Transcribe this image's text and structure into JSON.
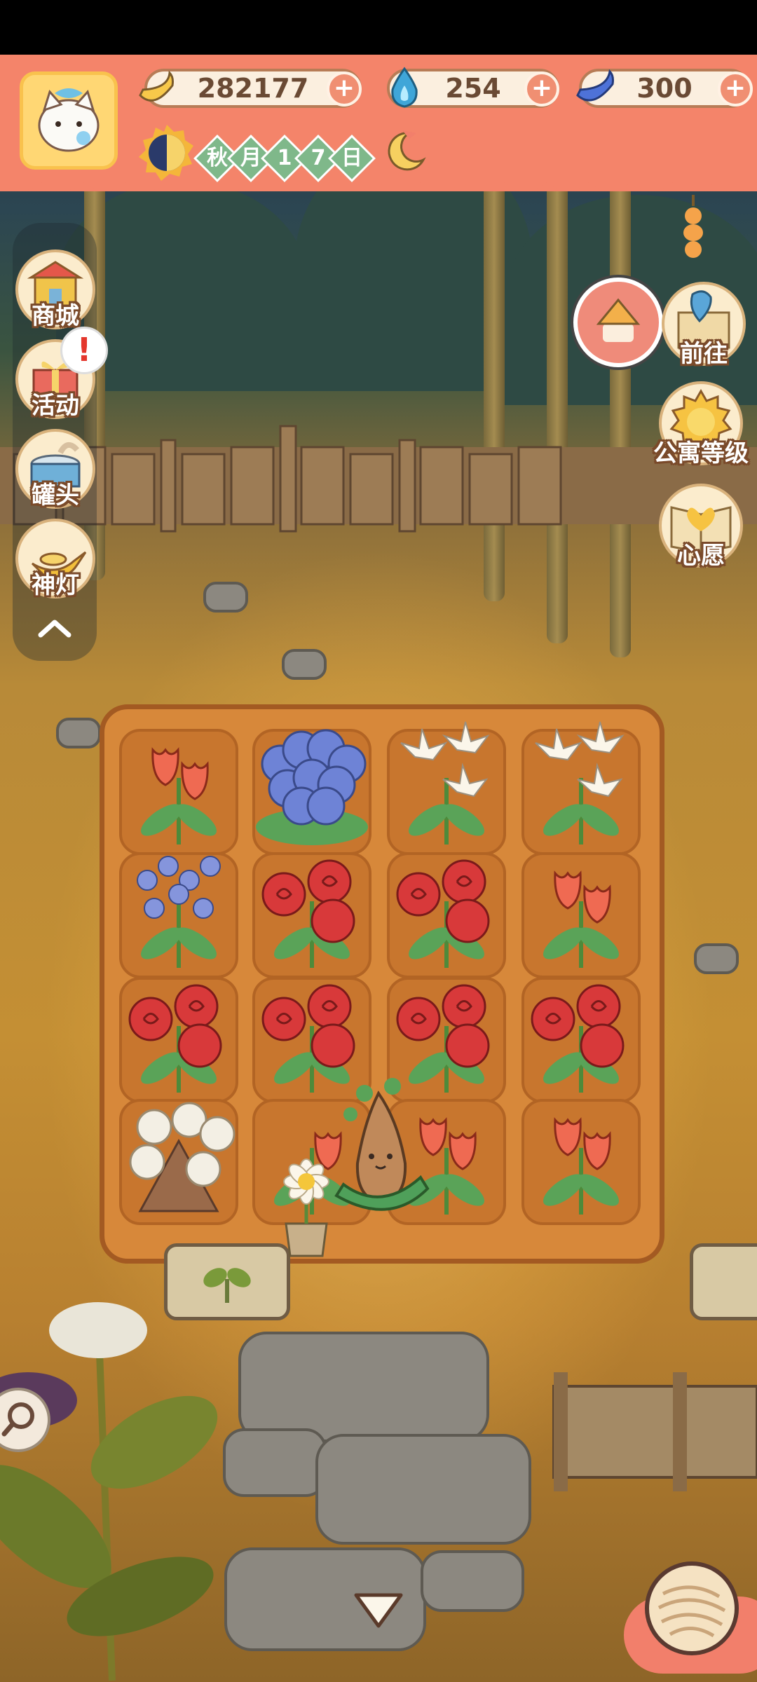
{
  "resources": {
    "banana": {
      "value": "282177",
      "icon": "banana-icon"
    },
    "flame": {
      "value": "254",
      "icon": "blue-flame-icon"
    },
    "blue_banana": {
      "value": "300",
      "icon": "blue-banana-icon"
    }
  },
  "date": {
    "chars": [
      "秋",
      "月",
      "1",
      "7",
      "日"
    ]
  },
  "left_menu": [
    {
      "label": "商城",
      "icon": "shop-icon"
    },
    {
      "label": "活动",
      "icon": "gift-icon"
    },
    {
      "label": "罐头",
      "icon": "can-icon"
    },
    {
      "label": "神灯",
      "icon": "magic-lamp-icon"
    }
  ],
  "right_menu": [
    {
      "label": "前往",
      "icon": "map-pin-icon"
    },
    {
      "label": "公寓等级",
      "icon": "sun-badge-icon"
    },
    {
      "label": "心愿",
      "icon": "wish-book-icon"
    }
  ],
  "alert_mark": "!",
  "garden": {
    "rows": [
      [
        "tulip",
        "hydrangea",
        "lily",
        "lily"
      ],
      [
        "bluebell",
        "rose",
        "rose",
        "tulip"
      ],
      [
        "rose",
        "rose",
        "rose",
        "rose"
      ],
      [
        "cotton",
        "daisy-pot",
        "tulip",
        "tulip"
      ]
    ]
  },
  "colors": {
    "header": "#f4846a",
    "plot": "#c8762e",
    "rose": "#d8393a",
    "tulip": "#ef6a52",
    "hydrangea": "#6e83d6",
    "lily": "#fbf6ea",
    "bluebell": "#8595dc",
    "cotton": "#f3efe4",
    "leaf": "#5aa358"
  }
}
